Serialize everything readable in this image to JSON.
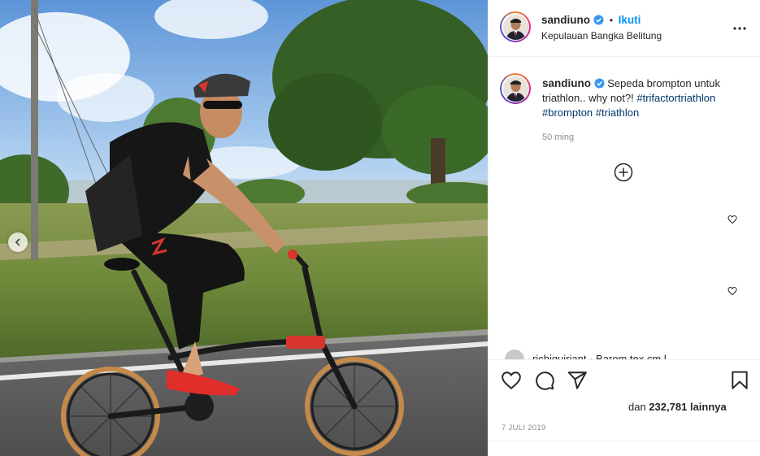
{
  "post": {
    "username": "sandiuno",
    "separator": "•",
    "follow_label": "Ikuti",
    "location": "Kepulauan Bangka Belitung",
    "caption_username": "sandiuno",
    "caption_text": "Sepeda brompton untuk triathlon.. why not?!",
    "hashtags": [
      "#trifactortriathlon",
      "#brompton",
      "#triathlon"
    ],
    "time_ago": "50 ming",
    "likes_prefix": "dan",
    "likes_count": "232,781",
    "likes_suffix": "lainnya",
    "date": "7 JULI 2019",
    "peek_comment": "richiquiriant · Barom tex  cm  l"
  },
  "icons": {
    "more": "more-options-icon",
    "verified": "verified-badge-icon",
    "load_more": "plus-circle-icon",
    "like": "heart-icon",
    "comment": "comment-icon",
    "share": "share-icon",
    "save": "bookmark-icon",
    "carousel_prev": "chevron-left-icon"
  },
  "colors": {
    "follow": "#0095f6",
    "hashtag": "#00376b",
    "verified": "#3897f0",
    "muted": "#8e8e8e",
    "text": "#262626"
  }
}
